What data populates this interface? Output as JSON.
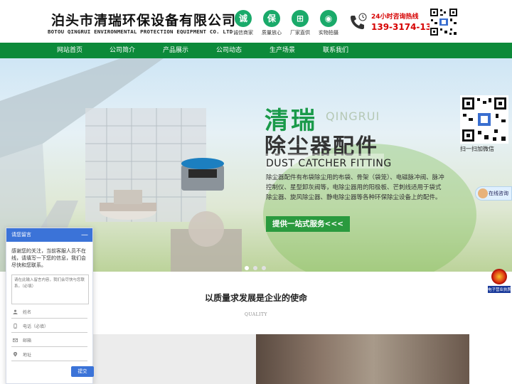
{
  "header": {
    "company_cn": "泊头市清瑞环保设备有限公司",
    "company_en": "BOTOU QINGRUI ENVIRONMENTAL PROTECTION EQUIPMENT CO. LTD",
    "badges": [
      {
        "char": "诚",
        "label": "诚信商家",
        "icon": "integrity-icon"
      },
      {
        "char": "保",
        "label": "质量放心",
        "icon": "quality-icon"
      },
      {
        "char": "⊞",
        "label": "厂家直供",
        "icon": "cart-icon"
      },
      {
        "char": "◉",
        "label": "实物拍摄",
        "icon": "camera-icon"
      }
    ],
    "hours_text": "24小时咨询热线",
    "hotline": "139-3174-1317",
    "phone_icon": "phone-24h-icon"
  },
  "nav": {
    "items": [
      {
        "label": "网站首页"
      },
      {
        "label": "公司简介"
      },
      {
        "label": "产品展示"
      },
      {
        "label": "公司动态"
      },
      {
        "label": "生产场景"
      },
      {
        "label": "联系我们"
      }
    ]
  },
  "banner": {
    "title_cn": "清瑞",
    "title_en": "QINGRUI",
    "subtitle_cn": "除尘器配件",
    "subtitle_en": "DUST CATCHER FITTING",
    "description": "除尘器配件有布袋除尘用的布袋、骨架（袋笼）、电磁脉冲阀、脉冲控制仪、星型卸灰阀等，电除尘器用的阳极板、芒刺线适用于袋式除尘器、旋风除尘器、静电除尘器等各种环保除尘设备上的配件。",
    "cta_label": "提供一站式服务<<<",
    "qr_caption": "扫一扫加微信",
    "consult_label": "在线咨询",
    "slides": 3,
    "active_slide": 1
  },
  "section": {
    "title": "以质量求发展是企业的使命",
    "subtitle": "QUALITY"
  },
  "police_badge": {
    "label": "电子营业执照"
  },
  "chat": {
    "header": "请您留言",
    "minimize": "—",
    "message": "感谢您的关注，当前客服人员不在线，请填写一下您的信息，我们会尽快和您联系。",
    "textarea_placeholder": "请在此输入留言内容，我们会尽快与您联系。（必填）",
    "fields": [
      {
        "placeholder": "姓名",
        "icon": "person-icon"
      },
      {
        "placeholder": "电话（必填）",
        "icon": "phone-icon"
      },
      {
        "placeholder": "邮箱",
        "icon": "mail-icon"
      },
      {
        "placeholder": "地址",
        "icon": "location-icon"
      }
    ],
    "submit_label": "提交"
  },
  "colors": {
    "brand_green": "#0c8a3a",
    "badge_green": "#1aaa6a",
    "hotline_red": "#d60000",
    "chat_blue": "#3b73d8"
  }
}
